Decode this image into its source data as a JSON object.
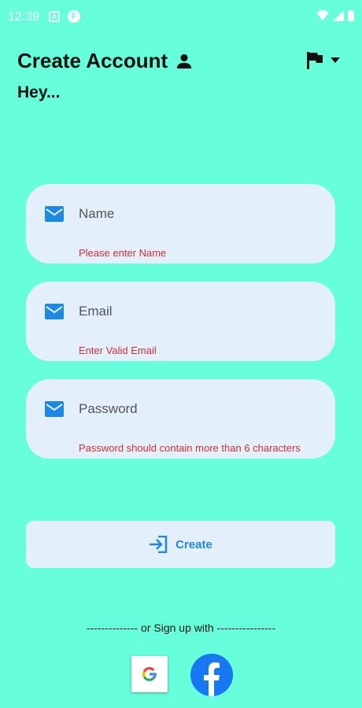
{
  "status_bar": {
    "time": "12:39"
  },
  "header": {
    "title": "Create Account",
    "subtitle": "Hey..."
  },
  "form": {
    "fields": [
      {
        "label": "Name",
        "error": "Please enter Name"
      },
      {
        "label": "Email",
        "error": "Enter Valid Email"
      },
      {
        "label": "Password",
        "error": "Password should contain more than 6 characters"
      }
    ],
    "submit_label": "Create"
  },
  "social": {
    "divider_text": "-------------- or Sign up with ----------------"
  },
  "colors": {
    "background": "#67ffdb",
    "field_bg": "#e3f0fb",
    "accent": "#1e88e5",
    "error": "#d32f2f",
    "facebook": "#1877f2"
  }
}
